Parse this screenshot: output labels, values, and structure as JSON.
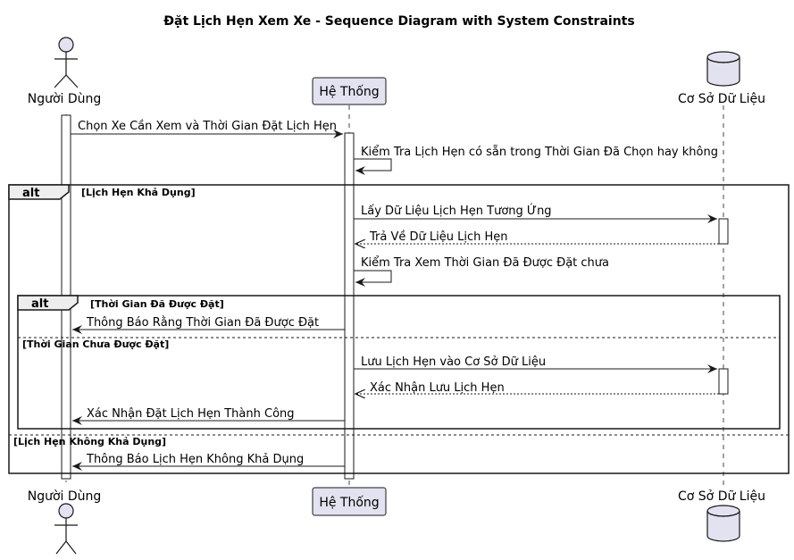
{
  "title": "Đặt Lịch Hẹn Xem Xe - Sequence Diagram with System Constraints",
  "participants": {
    "user": {
      "label": "Người Dùng",
      "type": "actor"
    },
    "system": {
      "label": "Hệ Thống",
      "type": "participant"
    },
    "database": {
      "label": "Cơ Sở Dữ Liệu",
      "type": "database"
    }
  },
  "messages": [
    {
      "text": "Chọn Xe Cần Xem và Thời Gian Đặt Lịch Hẹn",
      "from": "user",
      "to": "system",
      "style": "solid"
    },
    {
      "text": "Kiểm Tra Lịch Hẹn có sẵn trong Thời Gian Đã Chọn hay không",
      "from": "system",
      "to": "system",
      "style": "solid"
    },
    {
      "text": "Lấy Dữ Liệu Lịch Hẹn Tương Ứng",
      "from": "system",
      "to": "database",
      "style": "solid"
    },
    {
      "text": "Trả Về Dữ Liệu Lịch Hẹn",
      "from": "database",
      "to": "system",
      "style": "dashed"
    },
    {
      "text": "Kiểm Tra Xem Thời Gian Đã Được Đặt chưa",
      "from": "system",
      "to": "system",
      "style": "solid"
    },
    {
      "text": "Thông Báo Rằng Thời Gian Đã Được Đặt",
      "from": "system",
      "to": "user",
      "style": "solid"
    },
    {
      "text": "Lưu Lịch Hẹn vào Cơ Sở Dữ Liệu",
      "from": "system",
      "to": "database",
      "style": "solid"
    },
    {
      "text": "Xác Nhận Lưu Lịch Hẹn",
      "from": "database",
      "to": "system",
      "style": "dashed"
    },
    {
      "text": "Xác Nhận Đặt Lịch Hẹn Thành Công",
      "from": "system",
      "to": "user",
      "style": "solid"
    },
    {
      "text": "Thông Báo Lịch Hẹn Không Khả Dụng",
      "from": "system",
      "to": "user",
      "style": "solid"
    }
  ],
  "fragments": {
    "outer": {
      "keyword": "alt",
      "cond1": "[Lịch Hẹn Khả Dụng]",
      "cond2": "[Lịch Hẹn Không Khả Dụng]"
    },
    "inner": {
      "keyword": "alt",
      "cond1": "[Thời Gian Đã Được Đặt]",
      "cond2": "[Thời Gian Chưa Được Đặt]"
    }
  },
  "colors": {
    "participant_fill": "#e2e2f0",
    "fragment_header_fill": "#eeeeee",
    "line": "#181818"
  }
}
